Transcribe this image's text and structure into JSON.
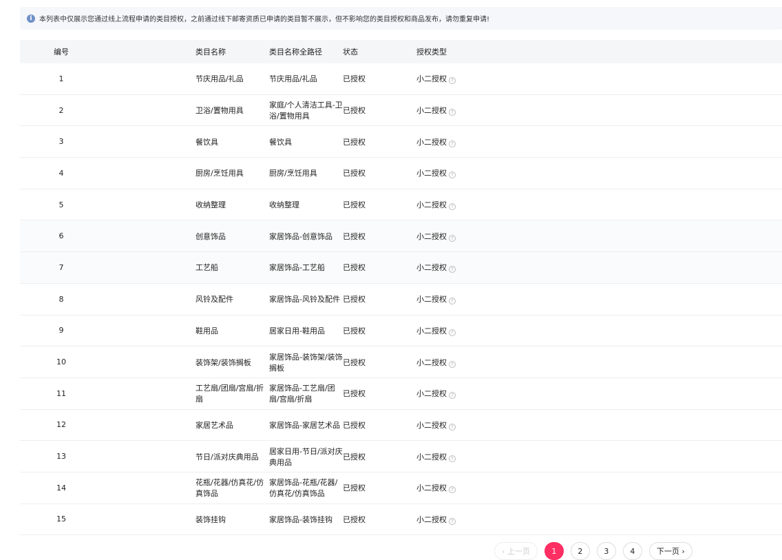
{
  "notice": {
    "icon": "info-icon",
    "text": "本列表中仅展示您通过线上流程申请的类目授权，之前通过线下邮寄资质已申请的类目暂不展示，但不影响您的类目授权和商品发布，请勿重复申请!"
  },
  "table": {
    "headers": {
      "id": "编号",
      "name": "类目名称",
      "path": "类目名称全路径",
      "status": "状态",
      "type": "授权类型"
    },
    "rows": [
      {
        "id": "1",
        "name": "节庆用品/礼品",
        "path": "节庆用品/礼品",
        "status": "已授权",
        "type": "小二授权"
      },
      {
        "id": "2",
        "name": "卫浴/置物用具",
        "path": "家庭/个人清洁工具-卫浴/置物用具",
        "status": "已授权",
        "type": "小二授权"
      },
      {
        "id": "3",
        "name": "餐饮具",
        "path": "餐饮具",
        "status": "已授权",
        "type": "小二授权"
      },
      {
        "id": "4",
        "name": "厨房/烹饪用具",
        "path": "厨房/烹饪用具",
        "status": "已授权",
        "type": "小二授权"
      },
      {
        "id": "5",
        "name": "收纳整理",
        "path": "收纳整理",
        "status": "已授权",
        "type": "小二授权"
      },
      {
        "id": "6",
        "name": "创意饰品",
        "path": "家居饰品-创意饰品",
        "status": "已授权",
        "type": "小二授权"
      },
      {
        "id": "7",
        "name": "工艺船",
        "path": "家居饰品-工艺船",
        "status": "已授权",
        "type": "小二授权"
      },
      {
        "id": "8",
        "name": "风铃及配件",
        "path": "家居饰品-风铃及配件",
        "status": "已授权",
        "type": "小二授权"
      },
      {
        "id": "9",
        "name": "鞋用品",
        "path": "居家日用-鞋用品",
        "status": "已授权",
        "type": "小二授权"
      },
      {
        "id": "10",
        "name": "装饰架/装饰搁板",
        "path": "家居饰品-装饰架/装饰搁板",
        "status": "已授权",
        "type": "小二授权"
      },
      {
        "id": "11",
        "name": "工艺扇/团扇/宫扇/折扇",
        "path": "家居饰品-工艺扇/团扇/宫扇/折扇",
        "status": "已授权",
        "type": "小二授权"
      },
      {
        "id": "12",
        "name": "家居艺术品",
        "path": "家居饰品-家居艺术品",
        "status": "已授权",
        "type": "小二授权"
      },
      {
        "id": "13",
        "name": "节日/派对庆典用品",
        "path": "居家日用-节日/派对庆典用品",
        "status": "已授权",
        "type": "小二授权"
      },
      {
        "id": "14",
        "name": "花瓶/花器/仿真花/仿真饰品",
        "path": "家居饰品-花瓶/花器/仿真花/仿真饰品",
        "status": "已授权",
        "type": "小二授权"
      },
      {
        "id": "15",
        "name": "装饰挂钩",
        "path": "家居饰品-装饰挂钩",
        "status": "已授权",
        "type": "小二授权"
      }
    ]
  },
  "pagination": {
    "prev_label": "‹ 上一页",
    "next_label": "下一页 ›",
    "pages": [
      "1",
      "2",
      "3",
      "4"
    ],
    "current": "1",
    "accent": "#ff2e63"
  }
}
